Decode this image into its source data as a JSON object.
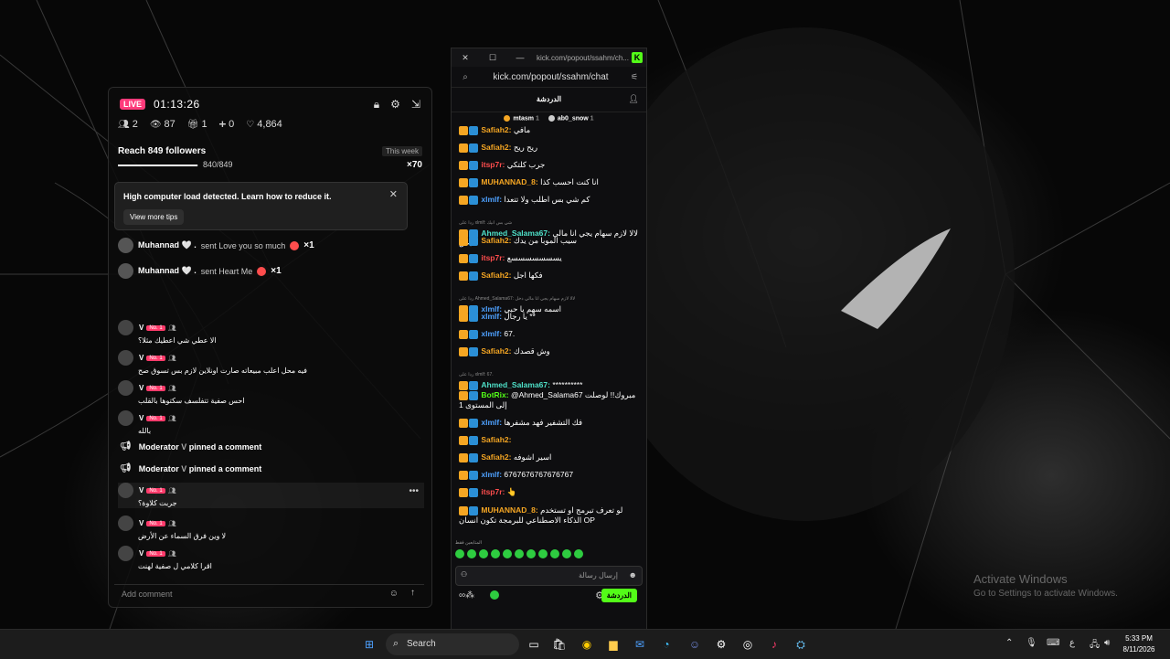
{
  "desktop": {
    "watermark_line1": "Activate Windows",
    "watermark_line2": "Go to Settings to activate Windows."
  },
  "stream_panel": {
    "live_label": "LIVE",
    "timer": "01:13:26",
    "stats": {
      "viewers": "2",
      "views": "87",
      "gifts": "1",
      "follows": "0",
      "likes": "4,864"
    },
    "goal": {
      "title": "Reach 849 followers",
      "progress_text": "840/849",
      "progress_fraction": 0.989,
      "week_label": "This week",
      "multiplier": "×70"
    },
    "toast": {
      "message": "High computer load detected. Learn how to reduce it.",
      "button": "View more tips"
    },
    "gifts": [
      {
        "user": "Muhannad 🤍 .",
        "text": "sent Love you so much",
        "count": "×1"
      },
      {
        "user": "Muhannad 🤍 .",
        "text": "sent Heart Me",
        "count": "×1"
      }
    ],
    "comments": [
      {
        "user": "V",
        "badge": "No. 1",
        "text": "الا عطي شي اعطيك مثلا؟"
      },
      {
        "user": "V",
        "badge": "No. 1",
        "text": "فيه محل اعلب مبيعاته صارت اونلاين لازم بس تسوق صح"
      },
      {
        "user": "V",
        "badge": "No. 1",
        "text": "احس صفية تتفلسف سكتوها بالقلب"
      },
      {
        "user": "V",
        "badge": "No. 1",
        "text": "بالله"
      }
    ],
    "moderator_notices": [
      {
        "role": "Moderator",
        "user": "V",
        "action": "pinned a comment"
      },
      {
        "role": "Moderator",
        "user": "V",
        "action": "pinned a comment"
      }
    ],
    "comments2": [
      {
        "user": "V",
        "badge": "No. 1",
        "text": "جربت كلاوة؟"
      },
      {
        "user": "V",
        "badge": "No. 1",
        "text": "لا وين فرق السماء عن الأرض"
      },
      {
        "user": "V",
        "badge": "No. 1",
        "text": "اقرا كلامي ل صفية لهنت"
      }
    ],
    "add_comment_placeholder": "Add comment"
  },
  "kick_window": {
    "title_url": "kick.com/popout/ssahm/ch...",
    "address": "kick.com/popout/ssahm/chat",
    "header_title": "الدردشة",
    "pinned_users": [
      {
        "name": "mtasm",
        "count": "1"
      },
      {
        "name": "ab0_snow",
        "count": "1"
      }
    ],
    "messages": [
      {
        "user": "Safiah2:",
        "color": "#f5a623",
        "text": "مافي"
      },
      {
        "user": "Safiah2:",
        "color": "#f5a623",
        "text": "ريح ريح"
      },
      {
        "user": "itsp7r:",
        "color": "#ff4d4d",
        "text": "جرب كلتكي"
      },
      {
        "user": "MUHANNAD_8:",
        "color": "#f5a623",
        "text": "انا كنت احسب كذا"
      },
      {
        "user": "xlmlf:",
        "color": "#4ea1ff",
        "text": "كم شي بس اطلب ولا تتعدا"
      },
      {
        "reply": "ردا على xlmlf: شي بس انيك",
        "user": "Ahmed_Salama67:",
        "color": "#4ee0c8",
        "text": "لالا لازم سهام يجي انا مالي دخل"
      },
      {
        "user": "Safiah2:",
        "color": "#f5a623",
        "text": "سيب الموبا من يدك"
      },
      {
        "user": "itsp7r:",
        "color": "#ff4d4d",
        "text": "يسسسسسسسع"
      },
      {
        "user": "Safiah2:",
        "color": "#f5a623",
        "text": "فكها اجل"
      },
      {
        "reply": "ردا على Ahmed_Salama67: لالا لازم سهام يجي انا مالي دخل",
        "user": "xlmlf:",
        "color": "#4ea1ff",
        "text": "اسمه سهم يا حبي"
      },
      {
        "user": "xlmlf:",
        "color": "#4ea1ff",
        "text": "يا رجال **"
      },
      {
        "user": "xlmlf:",
        "color": "#4ea1ff",
        "text": "67."
      },
      {
        "user": "Safiah2:",
        "color": "#f5a623",
        "text": "وش قصدك"
      },
      {
        "reply": "ردا على xlmlf: 67.",
        "user": "Ahmed_Salama67:",
        "color": "#4ee0c8",
        "text": "**********"
      },
      {
        "user": "BotRix:",
        "color": "#53fc18",
        "text": "@Ahmed_Salama67 مبروك!! لوصلت إلى المستوى 1"
      },
      {
        "user": "xlmlf:",
        "color": "#4ea1ff",
        "text": "فك التشفير فهد مشفرها"
      },
      {
        "user": "Safiah2:",
        "color": "#f5a623",
        "text": ""
      },
      {
        "user": "Safiah2:",
        "color": "#f5a623",
        "text": "اسير اشوفه"
      },
      {
        "user": "xlmlf:",
        "color": "#4ea1ff",
        "text": "6767676767676767"
      },
      {
        "user": "itsp7r:",
        "color": "#ff4d4d",
        "text": "👆"
      },
      {
        "user": "MUHANNAD_8:",
        "color": "#f5a623",
        "text": "لو تعرف تبرمج او تستخدم الذكاء الاصطناعي للبرمجة تكون انسان OP"
      }
    ],
    "followers_only": "المتابعين فقط",
    "input_placeholder": "إرسال رسالة",
    "send_button": "الدردشة"
  },
  "taskbar": {
    "search_label": "Search",
    "lang": "ع",
    "time": "5:33 PM",
    "date": "8/11/2026"
  }
}
